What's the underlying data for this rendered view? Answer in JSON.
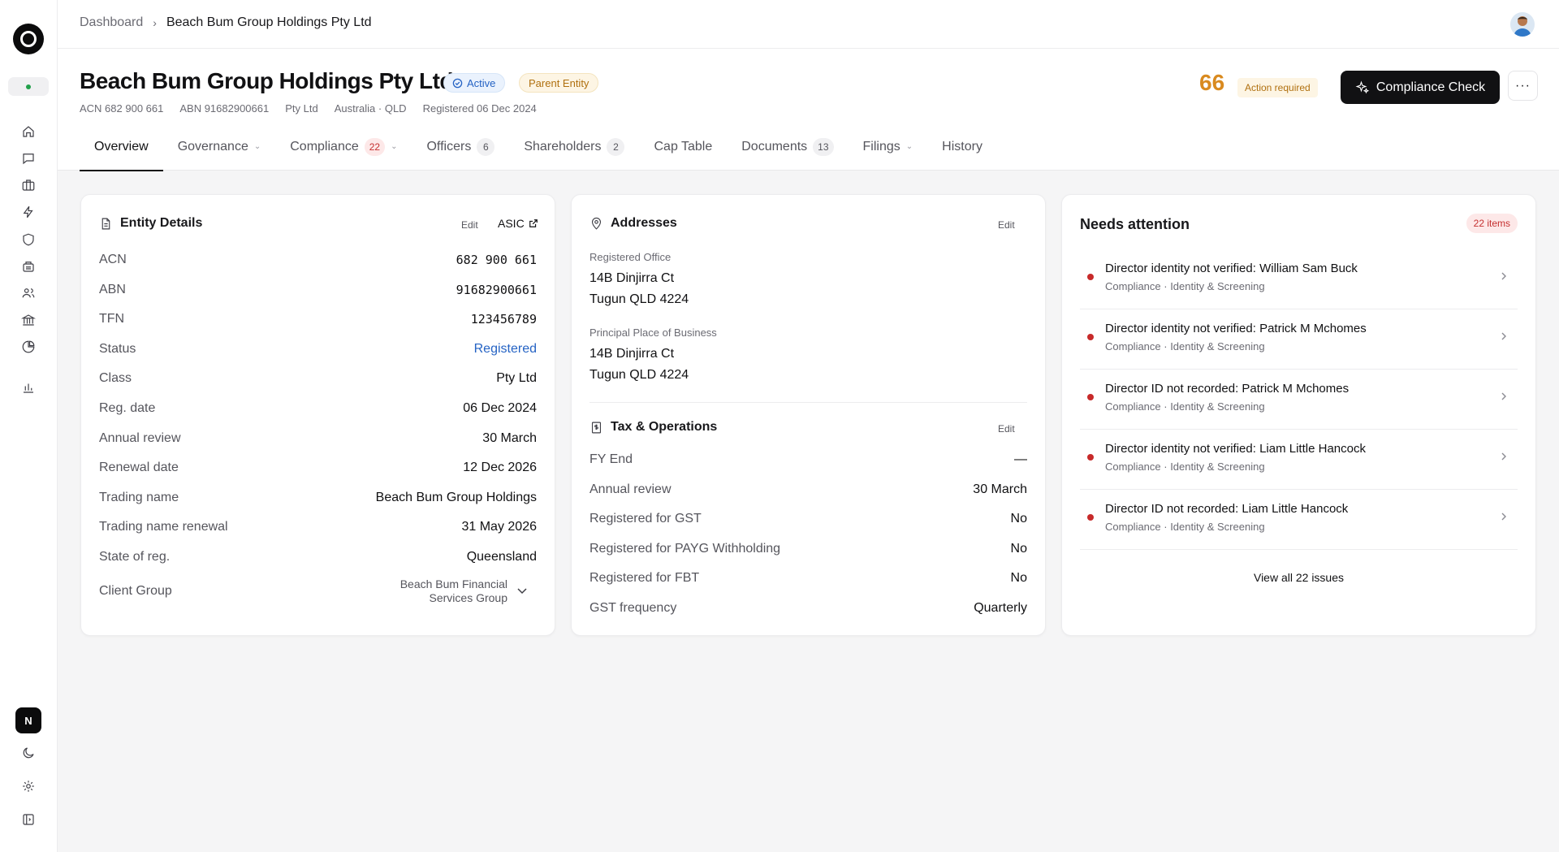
{
  "breadcrumb": {
    "root": "Dashboard",
    "current": "Beach Bum Group Holdings Pty Ltd"
  },
  "sidebar": {
    "user_initial": "N"
  },
  "header": {
    "title": "Beach Bum Group Holdings Pty Ltd",
    "status_badge": "Active",
    "type_badge": "Parent Entity",
    "meta": [
      "ACN 682 900 661",
      "ABN 91682900661",
      "Pty Ltd",
      "Australia · QLD",
      "Registered 06 Dec 2024"
    ],
    "score": "66",
    "score_label": "Action required",
    "compliance_button": "Compliance Check",
    "more_button": "···"
  },
  "tabs": [
    {
      "label": "Overview"
    },
    {
      "label": "Governance"
    },
    {
      "label": "Compliance",
      "count": "22"
    },
    {
      "label": "Officers",
      "count": "6"
    },
    {
      "label": "Shareholders",
      "count": "2"
    },
    {
      "label": "Cap Table"
    },
    {
      "label": "Documents",
      "count": "13"
    },
    {
      "label": "Filings"
    },
    {
      "label": "History"
    }
  ],
  "entity_details": {
    "title": "Entity Details",
    "edit": "Edit",
    "asic": "ASIC",
    "rows": [
      {
        "k": "ACN",
        "v": "682 900 661"
      },
      {
        "k": "ABN",
        "v": "91682900661"
      },
      {
        "k": "TFN",
        "v": "123456789"
      },
      {
        "k": "Status",
        "v": "Registered"
      },
      {
        "k": "Class",
        "v": "Pty Ltd"
      },
      {
        "k": "Reg. date",
        "v": "06 Dec 2024"
      },
      {
        "k": "Annual review",
        "v": "30 March"
      },
      {
        "k": "Renewal date",
        "v": "12 Dec 2026"
      },
      {
        "k": "Trading name",
        "v": "Beach Bum Group Holdings"
      },
      {
        "k": "Trading name renewal",
        "v": "31 May 2026"
      },
      {
        "k": "State of reg.",
        "v": "Queensland"
      },
      {
        "k": "Client Group",
        "v1": "Beach Bum Financial",
        "v2": "Services Group"
      }
    ]
  },
  "addresses": {
    "title": "Addresses",
    "edit": "Edit",
    "registered_label": "Registered Office",
    "registered_line1": "14B Dinjirra Ct",
    "registered_line2": "Tugun QLD 4224",
    "principal_label": "Principal Place of Business",
    "principal_line1": "14B Dinjirra Ct",
    "principal_line2": "Tugun QLD 4224"
  },
  "tax": {
    "title": "Tax & Operations",
    "edit": "Edit",
    "rows": [
      {
        "k": "FY End",
        "v": "—"
      },
      {
        "k": "Annual review",
        "v": "30 March"
      },
      {
        "k": "Registered for GST",
        "v": "No"
      },
      {
        "k": "Registered for PAYG Withholding",
        "v": "No"
      },
      {
        "k": "Registered for FBT",
        "v": "No"
      },
      {
        "k": "GST frequency",
        "v": "Quarterly"
      }
    ]
  },
  "attention": {
    "title": "Needs attention",
    "count": "22 items",
    "items": [
      {
        "main": "Director identity not verified: William Sam Buck",
        "sub": "Compliance · Identity & Screening"
      },
      {
        "main": "Director identity not verified: Patrick M Mchomes",
        "sub": "Compliance · Identity & Screening"
      },
      {
        "main": "Director ID not recorded: Patrick M Mchomes",
        "sub": "Compliance · Identity & Screening"
      },
      {
        "main": "Director identity not verified: Liam Little Hancock",
        "sub": "Compliance · Identity & Screening"
      },
      {
        "main": "Director ID not recorded: Liam Little Hancock",
        "sub": "Compliance · Identity & Screening"
      }
    ],
    "view_all": "View all 22 issues"
  },
  "colors": {
    "accent": "#111113",
    "warning": "#d98a1f",
    "danger": "#c72a2a",
    "link": "#2563c4",
    "success": "#22a04b"
  }
}
